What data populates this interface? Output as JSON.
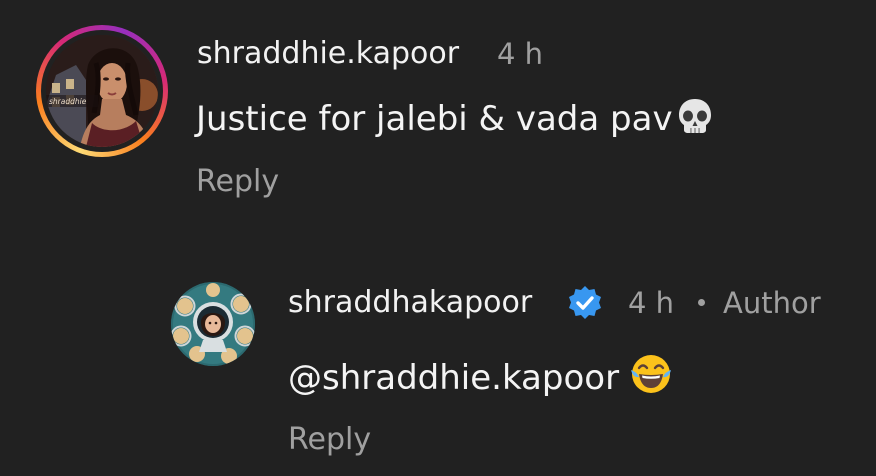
{
  "comments": [
    {
      "username": "shraddhie.kapoor",
      "time": "4 h",
      "text": "Justice for jalebi & vada pav",
      "emoji": "skull",
      "reply_label": "Reply",
      "avatar_watermark": "shraddhie",
      "has_story_ring": true
    },
    {
      "username": "shraddhakapoor",
      "verified": true,
      "time": "4 h",
      "author_badge": "Author",
      "text": "@shraddhie.kapoor",
      "emoji": "face-with-tears-of-joy",
      "reply_label": "Reply"
    }
  ],
  "colors": {
    "background": "#212121",
    "primary_text": "#f2f2f2",
    "secondary_text": "#a0a0a0",
    "verified_blue": "#3897f0",
    "story_ring": [
      "#feda75",
      "#fa7e1e",
      "#d62976",
      "#962fbf"
    ]
  }
}
